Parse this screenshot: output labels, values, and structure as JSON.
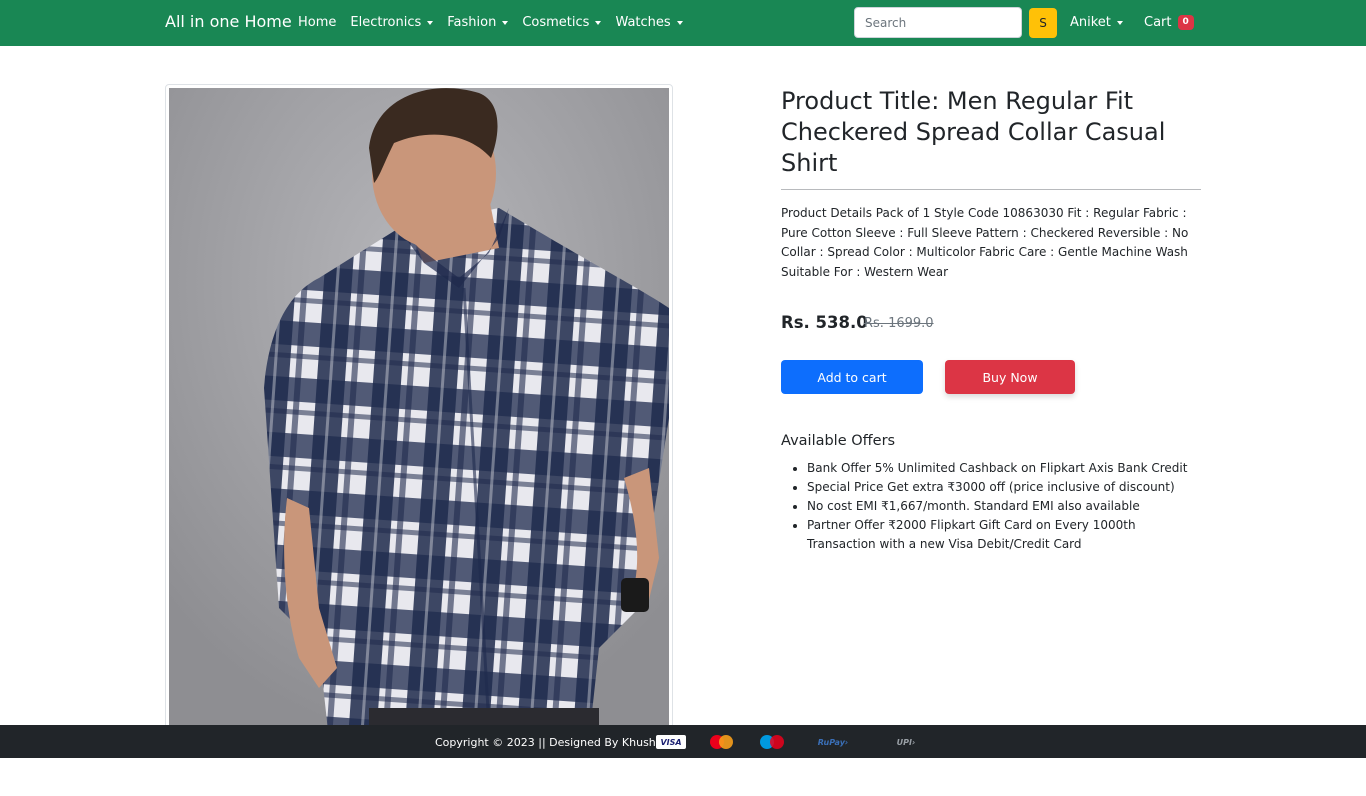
{
  "navbar": {
    "brand": "All in one Home",
    "links": [
      "Home",
      "Electronics",
      "Fashion",
      "Cosmetics",
      "Watches"
    ],
    "search_placeholder": "Search",
    "search_button": "S",
    "user": "Aniket",
    "cart_label": "Cart",
    "cart_count": "0"
  },
  "product": {
    "title": "Product Title: Men Regular Fit Checkered Spread Collar Casual Shirt",
    "details": "Product Details Pack of 1 Style Code 10863030 Fit : Regular Fabric : Pure Cotton Sleeve : Full Sleeve Pattern : Checkered Reversible : No Collar : Spread Color : Multicolor Fabric Care : Gentle Machine Wash Suitable For : Western Wear",
    "price": "Rs. 538.0",
    "old_price": "Rs. 1699.0",
    "add_to_cart": "Add to cart",
    "buy_now": "Buy Now",
    "image_icon": "product-photo"
  },
  "offers": {
    "title": "Available Offers",
    "items": [
      "Bank Offer 5% Unlimited Cashback on Flipkart Axis Bank Credit",
      "Special Price Get extra ₹3000 off (price inclusive of discount)",
      "No cost EMI ₹1,667/month. Standard EMI also available",
      "Partner Offer ₹2000 Flipkart Gift Card on Every 1000th Transaction with a new Visa Debit/Credit Card"
    ]
  },
  "footer": {
    "copyright": "Copyright © 2023 || Designed By Khushal ||",
    "payment_icons": [
      "visa",
      "mastercard",
      "maestro",
      "rupay",
      "upi"
    ]
  },
  "colors": {
    "navbar": "#198754",
    "search_button": "#ffc107",
    "badge": "#dc3545",
    "primary": "#0d6efd",
    "danger": "#dc3545",
    "footer": "#212529"
  }
}
